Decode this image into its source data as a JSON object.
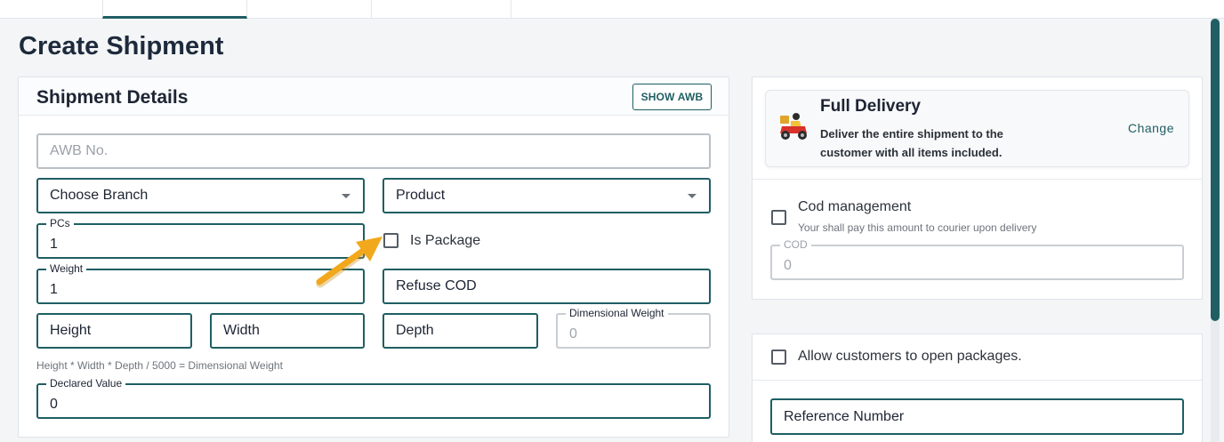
{
  "page": {
    "title": "Create Shipment"
  },
  "shipment_details": {
    "title": "Shipment Details",
    "show_awb_label": "SHOW AWB",
    "awb_placeholder": "AWB No.",
    "branch_value": "Choose Branch",
    "product_value": "Product",
    "pcs_label": "PCs",
    "pcs_value": "1",
    "is_package_label": "Is Package",
    "weight_label": "Weight",
    "weight_value": "1",
    "refuse_cod_value": "Refuse COD",
    "height_value": "Height",
    "width_value": "Width",
    "depth_value": "Depth",
    "dim_weight_label": "Dimensional Weight",
    "dim_weight_value": "0",
    "formula_hint": "Height * Width * Depth / 5000 = Dimensional Weight",
    "declared_value_label": "Declared Value",
    "declared_value_value": "0"
  },
  "delivery": {
    "title": "Full Delivery",
    "description": "Deliver the entire shipment to the customer with all items included.",
    "change_label": "Change",
    "icon": "delivery-scooter-icon"
  },
  "cod": {
    "label": "Cod management",
    "hint": "Your shall pay this amount to courier upon delivery",
    "field_label": "COD",
    "field_value": "0"
  },
  "packages": {
    "allow_open_label": "Allow customers to open packages.",
    "reference_value": "Reference Number"
  },
  "colors": {
    "accent": "#1f5e63",
    "arrow": "#f2a81d"
  }
}
